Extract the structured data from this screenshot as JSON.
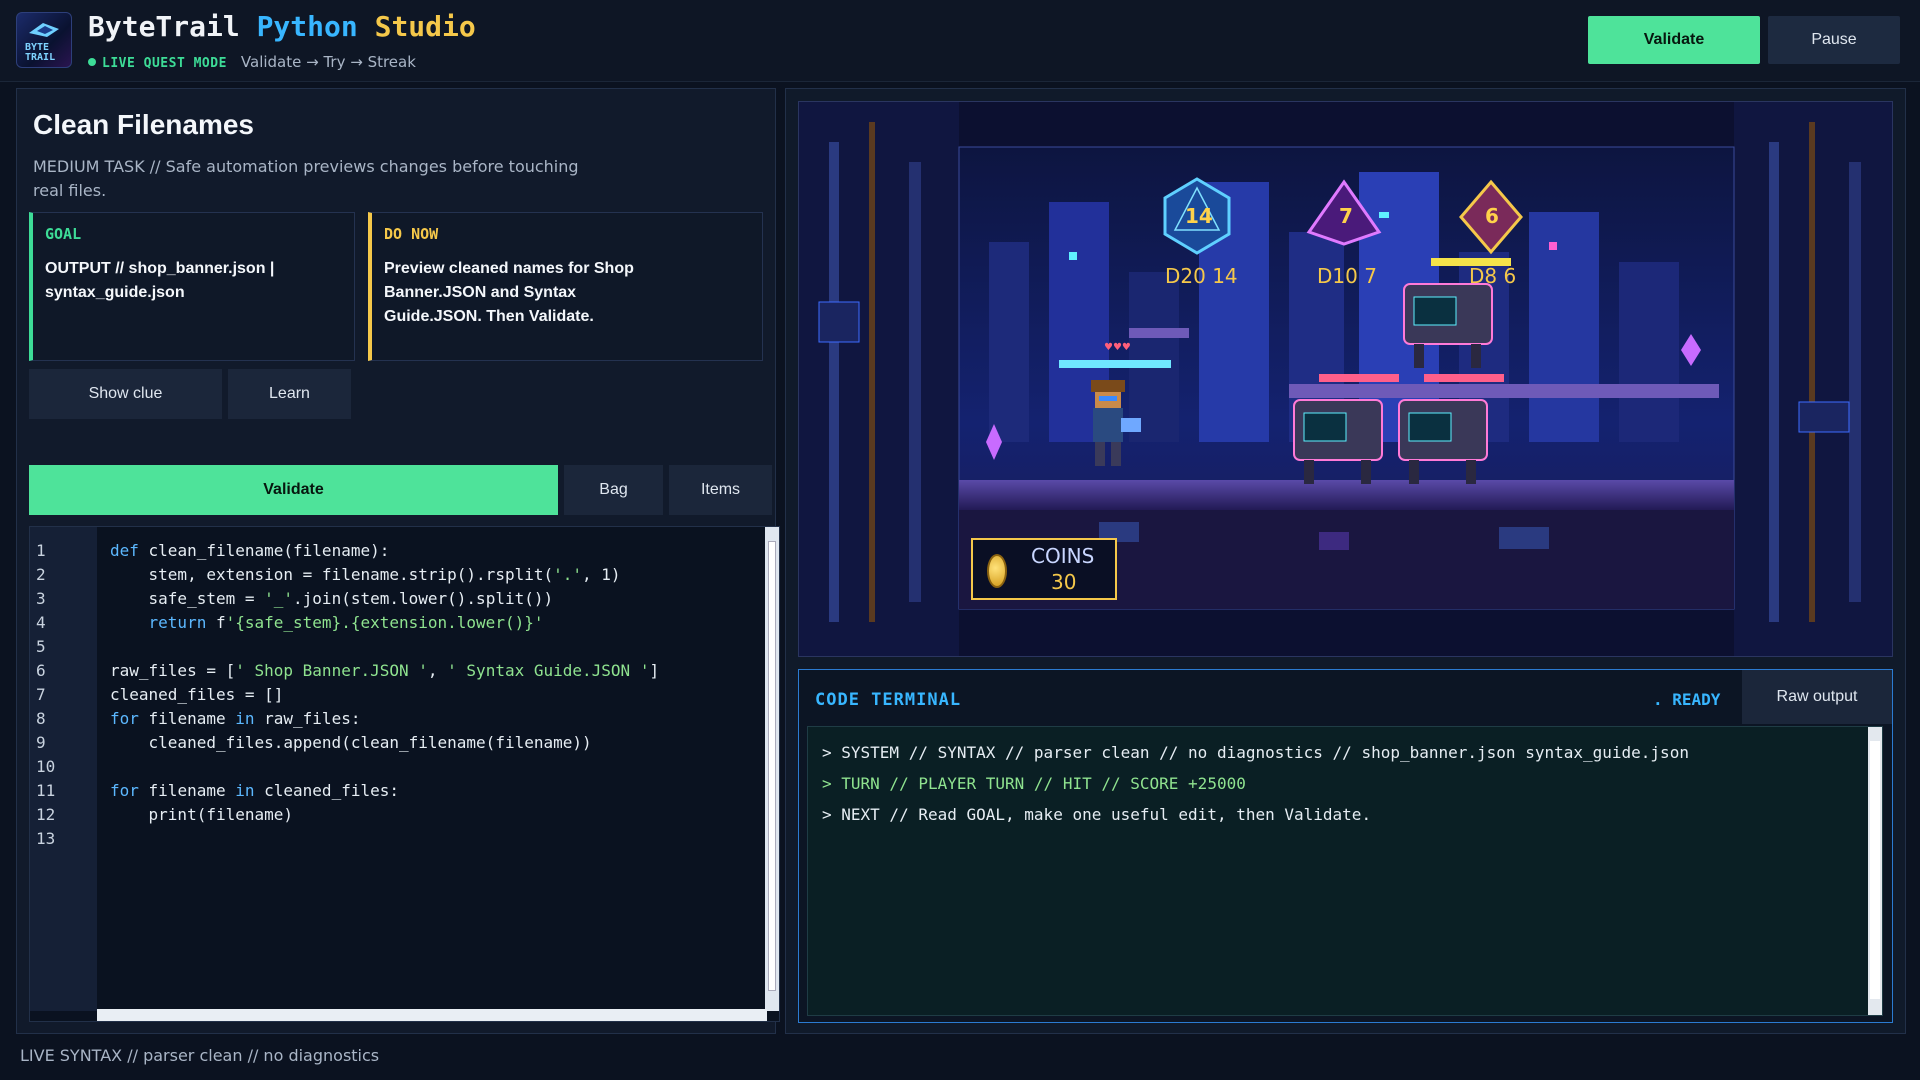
{
  "app": {
    "name_part1": "ByteTrail",
    "name_part2": "Python",
    "name_part3": "Studio",
    "logo_text_1": "BYTE",
    "logo_text_2": "TRAIL",
    "live_mode": "LIVE QUEST MODE",
    "flow": "Validate → Try → Streak"
  },
  "header": {
    "validate_label": "Validate",
    "pause_label": "Pause"
  },
  "task": {
    "title": "Clean Filenames",
    "description": "MEDIUM TASK // Safe automation previews changes before touching real files.",
    "goal_heading": "GOAL",
    "goal_text": "OUTPUT // shop_banner.json | syntax_guide.json",
    "donow_heading": "DO NOW",
    "donow_text": "Preview cleaned names for Shop Banner.JSON and Syntax Guide.JSON. Then Validate.",
    "show_clue_label": "Show clue",
    "learn_label": "Learn"
  },
  "editor_toolbar": {
    "validate_label": "Validate",
    "bag_label": "Bag",
    "items_label": "Items"
  },
  "code": {
    "line_numbers": [
      "1",
      "2",
      "3",
      "4",
      "5",
      "6",
      "7",
      "8",
      "9",
      "10",
      "11",
      "12",
      "13"
    ],
    "lines": [
      "def clean_filename(filename):",
      "    stem, extension = filename.strip().rsplit('.', 1)",
      "    safe_stem = '_'.join(stem.lower().split())",
      "    return f'{safe_stem}.{extension.lower()}'",
      "",
      "raw_files = [' Shop Banner.JSON ', ' Syntax Guide.JSON ']",
      "cleaned_files = []",
      "for filename in raw_files:",
      "    cleaned_files.append(clean_filename(filename))",
      "",
      "for filename in cleaned_files:",
      "    print(filename)",
      ""
    ]
  },
  "game": {
    "dice": [
      {
        "value": "14",
        "label": "D20 14",
        "color": "#38b6ff"
      },
      {
        "value": "7",
        "label": "D10 7",
        "color": "#c86bff"
      },
      {
        "value": "6",
        "label": "D8 6",
        "color": "#f5c84a"
      }
    ],
    "coins_label": "COINS",
    "coins_value": "30"
  },
  "terminal": {
    "title": "CODE TERMINAL",
    "status": ". READY",
    "raw_output_label": "Raw output",
    "lines": [
      "> SYSTEM // SYNTAX // parser clean // no diagnostics // shop_banner.json syntax_guide.json",
      "> TURN // PLAYER TURN // HIT // SCORE +25000",
      "> NEXT // Read GOAL, make one useful edit, then Validate."
    ]
  },
  "status_bar": {
    "text": "LIVE SYNTAX // parser clean // no diagnostics"
  },
  "colors": {
    "accent_green": "#4ee39a",
    "accent_blue": "#38b6ff",
    "accent_yellow": "#f5c84a",
    "background": "#0b1220"
  }
}
